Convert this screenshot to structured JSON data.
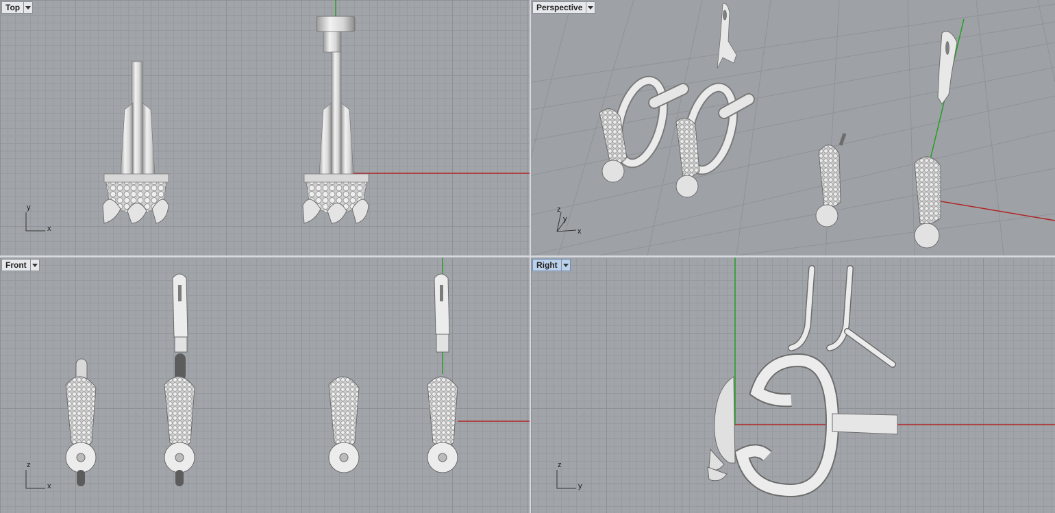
{
  "viewports": {
    "top": {
      "label": "Top",
      "axis": {
        "a": "y",
        "b": "x"
      }
    },
    "perspective": {
      "label": "Perspective",
      "axis": {
        "up": "z",
        "a": "y",
        "b": "x"
      }
    },
    "front": {
      "label": "Front",
      "axis": {
        "a": "z",
        "b": "x"
      }
    },
    "right": {
      "label": "Right",
      "axis": {
        "a": "z",
        "b": "y"
      },
      "active": true
    }
  },
  "icons": {
    "viewport_menu": "dropdown-arrow-icon"
  },
  "colors": {
    "x_axis": "#b02424",
    "y_axis": "#22a022",
    "active_tab": "#bcd2ea",
    "model": "#e8e8e8"
  }
}
